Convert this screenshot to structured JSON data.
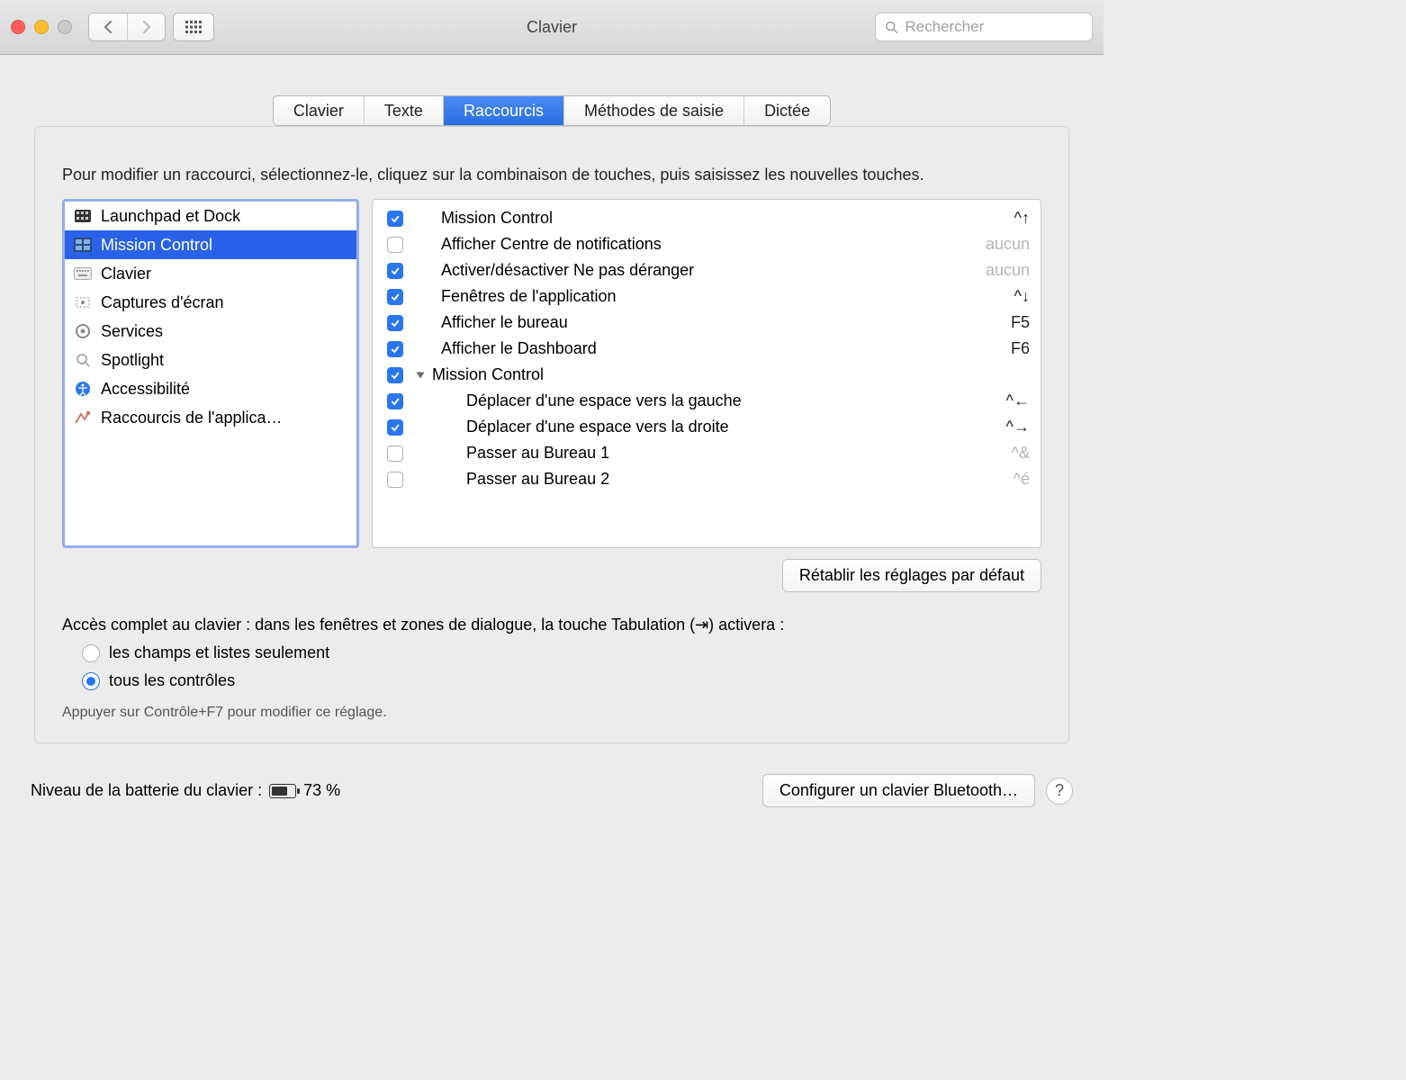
{
  "window": {
    "title": "Clavier"
  },
  "search": {
    "placeholder": "Rechercher"
  },
  "tabs": [
    "Clavier",
    "Texte",
    "Raccourcis",
    "Méthodes de saisie",
    "Dictée"
  ],
  "active_tab": 2,
  "instruction": "Pour modifier un raccourci, sélectionnez-le, cliquez sur la combinaison de touches, puis saisissez les nouvelles touches.",
  "categories": [
    {
      "label": "Launchpad et Dock",
      "icon": "launchpad"
    },
    {
      "label": "Mission Control",
      "icon": "mission",
      "selected": true
    },
    {
      "label": "Clavier",
      "icon": "keyboard"
    },
    {
      "label": "Captures d'écran",
      "icon": "capture"
    },
    {
      "label": "Services",
      "icon": "gear"
    },
    {
      "label": "Spotlight",
      "icon": "spotlight"
    },
    {
      "label": "Accessibilité",
      "icon": "accessibility"
    },
    {
      "label": "Raccourcis de l'applica…",
      "icon": "appsc"
    }
  ],
  "shortcuts": [
    {
      "checked": true,
      "label": "Mission Control",
      "key": "^↑"
    },
    {
      "checked": false,
      "label": "Afficher Centre de notifications",
      "key": "aucun",
      "keydim": true
    },
    {
      "checked": true,
      "label": "Activer/désactiver Ne pas déranger",
      "key": "aucun",
      "keydim": true
    },
    {
      "checked": true,
      "label": "Fenêtres de l'application",
      "key": "^↓"
    },
    {
      "checked": true,
      "label": "Afficher le bureau",
      "key": "F5"
    },
    {
      "checked": true,
      "label": "Afficher le Dashboard",
      "key": "F6"
    },
    {
      "checked": true,
      "group": true,
      "label": "Mission Control"
    },
    {
      "checked": true,
      "sub": true,
      "label": "Déplacer d'une espace vers la gauche",
      "key": "^←"
    },
    {
      "checked": true,
      "sub": true,
      "label": "Déplacer d'une espace vers la droite",
      "key": "^→"
    },
    {
      "checked": false,
      "sub": true,
      "label": "Passer au Bureau 1",
      "key": "^&",
      "keydim": true
    },
    {
      "checked": false,
      "sub": true,
      "label": "Passer au Bureau 2",
      "key": "^é",
      "keydim": true
    }
  ],
  "restore": "Rétablir les réglages par défaut",
  "access_intro": "Accès complet au clavier : dans les fenêtres et zones de dialogue, la touche Tabulation (⇥) activera :",
  "access_options": [
    {
      "label": "les champs et listes seulement",
      "on": false
    },
    {
      "label": "tous les contrôles",
      "on": true
    }
  ],
  "access_hint": "Appuyer sur Contrôle+F7 pour modifier ce réglage.",
  "battery": {
    "label": "Niveau de la batterie du clavier :",
    "percent": "73 %"
  },
  "bluetooth_btn": "Configurer un clavier Bluetooth…",
  "help": "?"
}
